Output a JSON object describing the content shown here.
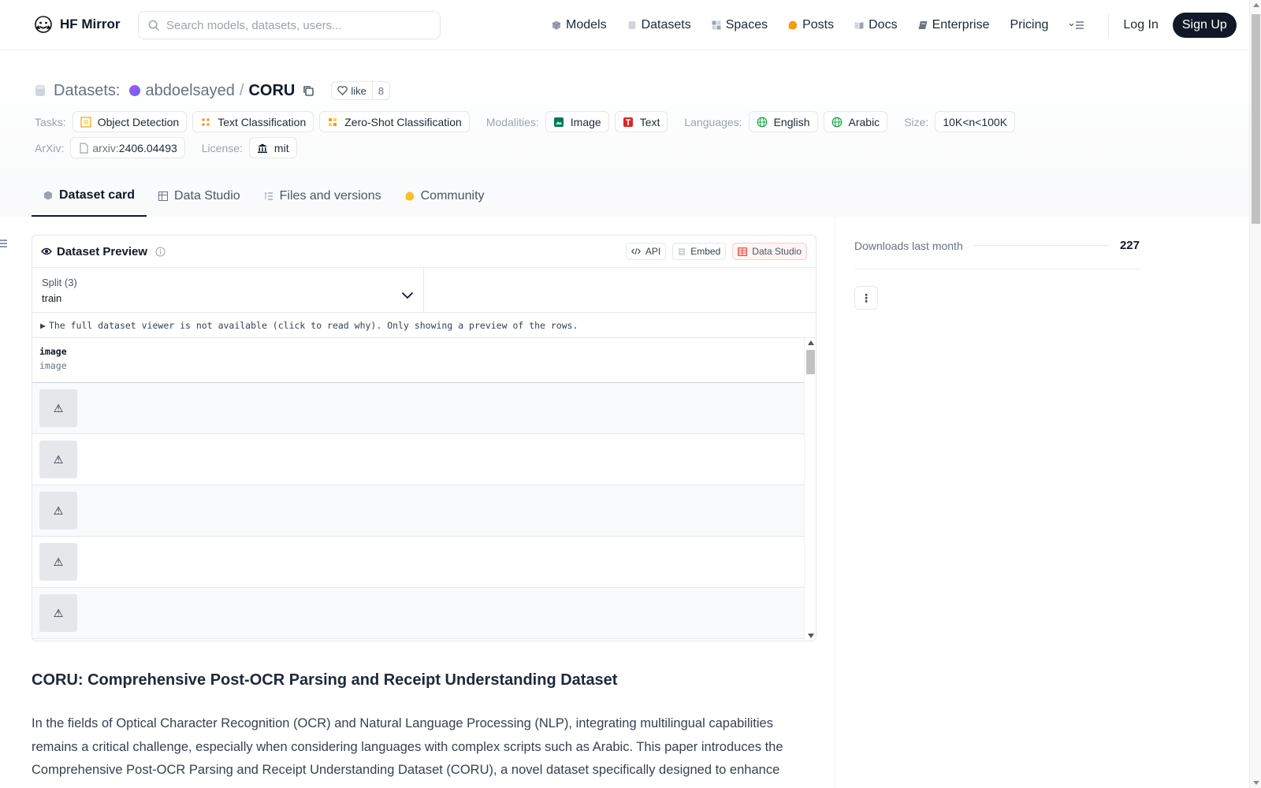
{
  "brand": {
    "name": "HF Mirror"
  },
  "search": {
    "placeholder": "Search models, datasets, users..."
  },
  "nav": {
    "models": "Models",
    "datasets": "Datasets",
    "spaces": "Spaces",
    "posts": "Posts",
    "docs": "Docs",
    "enterprise": "Enterprise",
    "pricing": "Pricing",
    "login": "Log In",
    "signup": "Sign Up"
  },
  "repo": {
    "type_label": "Datasets:",
    "owner": "abdoelsayed",
    "separator": "/",
    "name": "CORU",
    "like_label": "like",
    "like_count": "8"
  },
  "tags": {
    "tasks_label": "Tasks:",
    "tasks": [
      "Object Detection",
      "Text Classification",
      "Zero-Shot Classification"
    ],
    "modalities_label": "Modalities:",
    "modalities": [
      "Image",
      "Text"
    ],
    "languages_label": "Languages:",
    "languages": [
      "English",
      "Arabic"
    ],
    "size_label": "Size:",
    "size": "10K<n<100K",
    "arxiv_label": "ArXiv:",
    "arxiv_prefix": "arxiv:",
    "arxiv_id": "2406.04493",
    "license_label": "License:",
    "license": "mit"
  },
  "tabs": {
    "card": "Dataset card",
    "studio": "Data Studio",
    "files": "Files and versions",
    "community": "Community"
  },
  "preview": {
    "title": "Dataset Preview",
    "api": "API",
    "embed": "Embed",
    "studio": "Data Studio",
    "split_label": "Split (3)",
    "split_value": "train",
    "notice": "The full dataset viewer is not available (click to read why). Only showing a preview of the rows.",
    "notice_marker": "▶",
    "column_name": "image",
    "column_type": "image",
    "row_icon": "⚠"
  },
  "doc": {
    "title": "CORU: Comprehensive Post-OCR Parsing and Receipt Understanding Dataset",
    "paragraph": "In the fields of Optical Character Recognition (OCR) and Natural Language Processing (NLP), integrating multilingual capabilities remains a critical challenge, especially when considering languages with complex scripts such as Arabic. This paper introduces the Comprehensive Post-OCR Parsing and Receipt Understanding Dataset (CORU), a novel dataset specifically designed to enhance OCR"
  },
  "sidebar": {
    "downloads_label": "Downloads last month",
    "downloads_value": "227",
    "menu_icon": "⋮"
  },
  "colors": {
    "signup_bg": "#111827",
    "studio_accent": "#ef4444",
    "avatar_gradient": "#a855f7"
  }
}
